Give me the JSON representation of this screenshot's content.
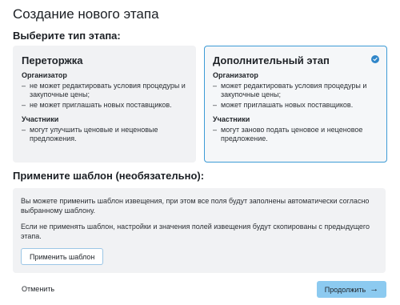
{
  "page": {
    "title": "Создание нового этапа",
    "type_heading": "Выберите тип этапа:",
    "template_heading": "Примените шаблон (необязательно):"
  },
  "cards": {
    "left": {
      "title": "Переторжка",
      "organizer_label": "Организатор",
      "organizer_items": [
        "не может редактировать условия процедуры и закупочные цены;",
        "не может приглашать новых поставщиков."
      ],
      "participants_label": "Участники",
      "participants_items": [
        "могут улучшить ценовые и неценовые предложения."
      ],
      "selected": false
    },
    "right": {
      "title": "Дополнительный этап",
      "organizer_label": "Организатор",
      "organizer_items": [
        "может редактировать условия процедуры и закупочные цены;",
        "может приглашать новых поставщиков."
      ],
      "participants_label": "Участники",
      "participants_items": [
        "могут заново подать ценовое и неценовое предложение."
      ],
      "selected": true
    }
  },
  "template": {
    "text1": "Вы можете применить шаблон извещения, при этом все поля будут заполнены автоматически согласно выбранному шаблону.",
    "text2": "Если не применять шаблон, настройки и значения полей извещения будут скопированы с предыдущего этапа.",
    "apply_label": "Применить шаблон"
  },
  "footer": {
    "cancel_label": "Отменить",
    "next_label": "Продолжить",
    "next_icon": "arrow-right-icon"
  },
  "colors": {
    "accent": "#2f86c9",
    "selected_border": "#3d9bd6",
    "primary_button": "#8ccaf0",
    "panel_bg": "#f1f2f4"
  }
}
